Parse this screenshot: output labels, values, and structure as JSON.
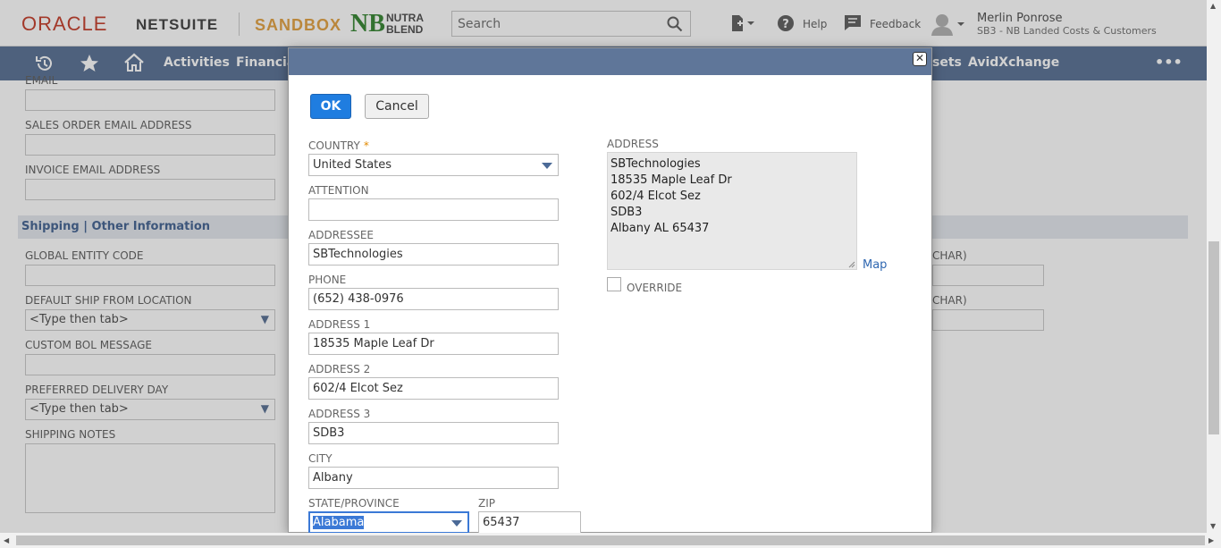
{
  "header": {
    "brand_oracle": "ORACLE",
    "brand_netsuite": "NETSUITE",
    "env_label": "SANDBOX",
    "company_logo_line1": "NUTRA",
    "company_logo_line2": "BLEND",
    "search_placeholder": "Search",
    "help_label": "Help",
    "feedback_label": "Feedback",
    "user_name": "Merlin Ponrose",
    "user_role": "SB3 - NB Landed Costs & Customers"
  },
  "nav": {
    "items": [
      "Activities",
      "Financial",
      "sets",
      "AvidXchange"
    ],
    "more_label": "•••"
  },
  "background_form": {
    "email_label": "EMAIL",
    "sales_order_email_label": "SALES ORDER EMAIL ADDRESS",
    "invoice_email_label": "INVOICE EMAIL ADDRESS",
    "section_title": "Shipping | Other Information",
    "global_entity_code_label": "GLOBAL ENTITY CODE",
    "default_ship_from_label": "DEFAULT SHIP FROM LOCATION",
    "default_ship_from_value": "<Type then tab>",
    "custom_bol_label": "CUSTOM BOL MESSAGE",
    "preferred_delivery_label": "PREFERRED DELIVERY DAY",
    "preferred_delivery_value": "<Type then tab>",
    "shipping_notes_label": "SHIPPING NOTES",
    "right_label_1": "CHAR)",
    "right_label_2": "CHAR)"
  },
  "modal": {
    "ok_label": "OK",
    "cancel_label": "Cancel",
    "close_label": "✕",
    "country_label": "COUNTRY",
    "country_required": "*",
    "country_value": "United States",
    "attention_label": "ATTENTION",
    "attention_value": "",
    "addressee_label": "ADDRESSEE",
    "addressee_value": "SBTechnologies",
    "phone_label": "PHONE",
    "phone_value": "(652) 438-0976",
    "address1_label": "ADDRESS 1",
    "address1_value": "18535 Maple Leaf Dr",
    "address2_label": "ADDRESS 2",
    "address2_value": "602/4 Elcot Sez",
    "address3_label": "ADDRESS 3",
    "address3_value": "SDB3",
    "city_label": "CITY",
    "city_value": "Albany",
    "state_label": "STATE/PROVINCE",
    "state_value": "Alabama",
    "zip_label": "ZIP",
    "zip_value": "65437",
    "address_label": "ADDRESS",
    "address_text": "SBTechnologies\n18535 Maple Leaf Dr\n602/4 Elcot Sez\nSDB3\nAlbany AL 65437",
    "map_label": "Map",
    "override_label": "OVERRIDE"
  },
  "colors": {
    "nav_bg": "#607799",
    "ok_button": "#1f7de0",
    "required_star": "#e28a00",
    "oracle_red": "#c74634",
    "sandbox_orange": "#e3a54a"
  }
}
